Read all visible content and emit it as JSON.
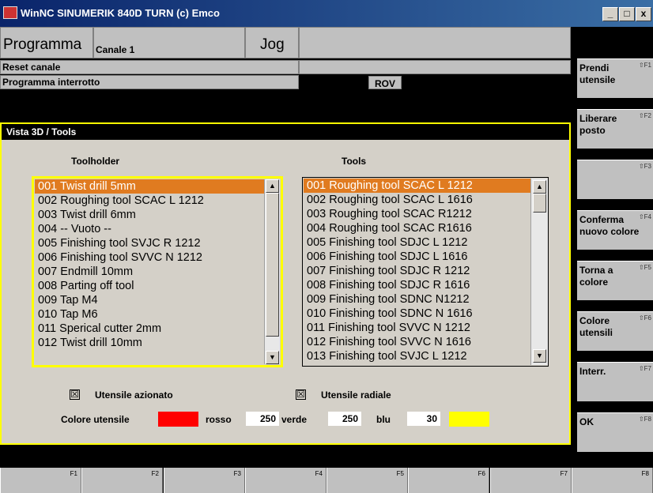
{
  "window": {
    "title": "WinNC SINUMERIK 840D TURN (c) Emco",
    "minimize": "_",
    "maximize": "□",
    "close": "x"
  },
  "status": {
    "mode_label": "Programma",
    "channel": "Canale 1",
    "jog": "Jog",
    "reset": "Reset canale",
    "program_state": "Programma interrotto",
    "rov": "ROV"
  },
  "panel": {
    "title": "Vista 3D / Tools",
    "toolholder_header": "Toolholder",
    "tools_header": "Tools",
    "toolholder_items": [
      "001 Twist drill 5mm",
      "002 Roughing tool SCAC L 1212",
      "003 Twist drill 6mm",
      "004 -- Vuoto --",
      "005 Finishing tool SVJC R 1212",
      "006 Finishing tool SVVC N 1212",
      "007 Endmill 10mm",
      "008 Parting off tool",
      "009 Tap M4",
      "010 Tap M6",
      "011 Sperical cutter 2mm",
      "012 Twist drill 10mm"
    ],
    "tools_items": [
      "001 Roughing tool SCAC L 1212",
      "002 Roughing tool SCAC L 1616",
      "003 Roughing tool SCAC R1212",
      "004 Roughing tool SCAC R1616",
      "005 Finishing tool SDJC L 1212",
      "006 Finishing tool SDJC L 1616",
      "007 Finishing tool SDJC R 1212",
      "008 Finishing tool SDJC R 1616",
      "009 Finishing tool SDNC N1212",
      "010 Finishing tool SDNC N 1616",
      "011 Finishing tool SVVC N 1212",
      "012 Finishing tool SVVC N 1616",
      "013 Finishing tool SVJC L 1212"
    ],
    "check_driven": "Utensile azionato",
    "check_radial": "Utensile radiale",
    "color_label": "Colore utensile",
    "color_swatch": "#ff0000",
    "red_label": "rosso",
    "red_value": "250",
    "green_label": "verde",
    "green_value": "250",
    "blue_label": "blu",
    "blue_value": "30",
    "mixed_swatch": "#ffff00",
    "check_mark": "☒"
  },
  "softkeys": [
    {
      "line1": "Prendi",
      "line2": "utensile",
      "key": "⇧F1"
    },
    {
      "line1": "Liberare",
      "line2": "posto",
      "key": "⇧F2"
    },
    {
      "line1": "",
      "line2": "",
      "key": "⇧F3"
    },
    {
      "line1": "Conferma",
      "line2": "nuovo colore",
      "key": "⇧F4"
    },
    {
      "line1": "Torna a",
      "line2": "colore",
      "key": "⇧F5"
    },
    {
      "line1": "Colore",
      "line2": "utensili",
      "key": "⇧F6"
    },
    {
      "line1": "Interr.",
      "line2": "",
      "key": "⇧F7"
    },
    {
      "line1": "OK",
      "line2": "",
      "key": "⇧F8"
    }
  ],
  "fkeys": [
    "F1",
    "F2",
    "F3",
    "F4",
    "F5",
    "F6",
    "F7",
    "F8"
  ]
}
